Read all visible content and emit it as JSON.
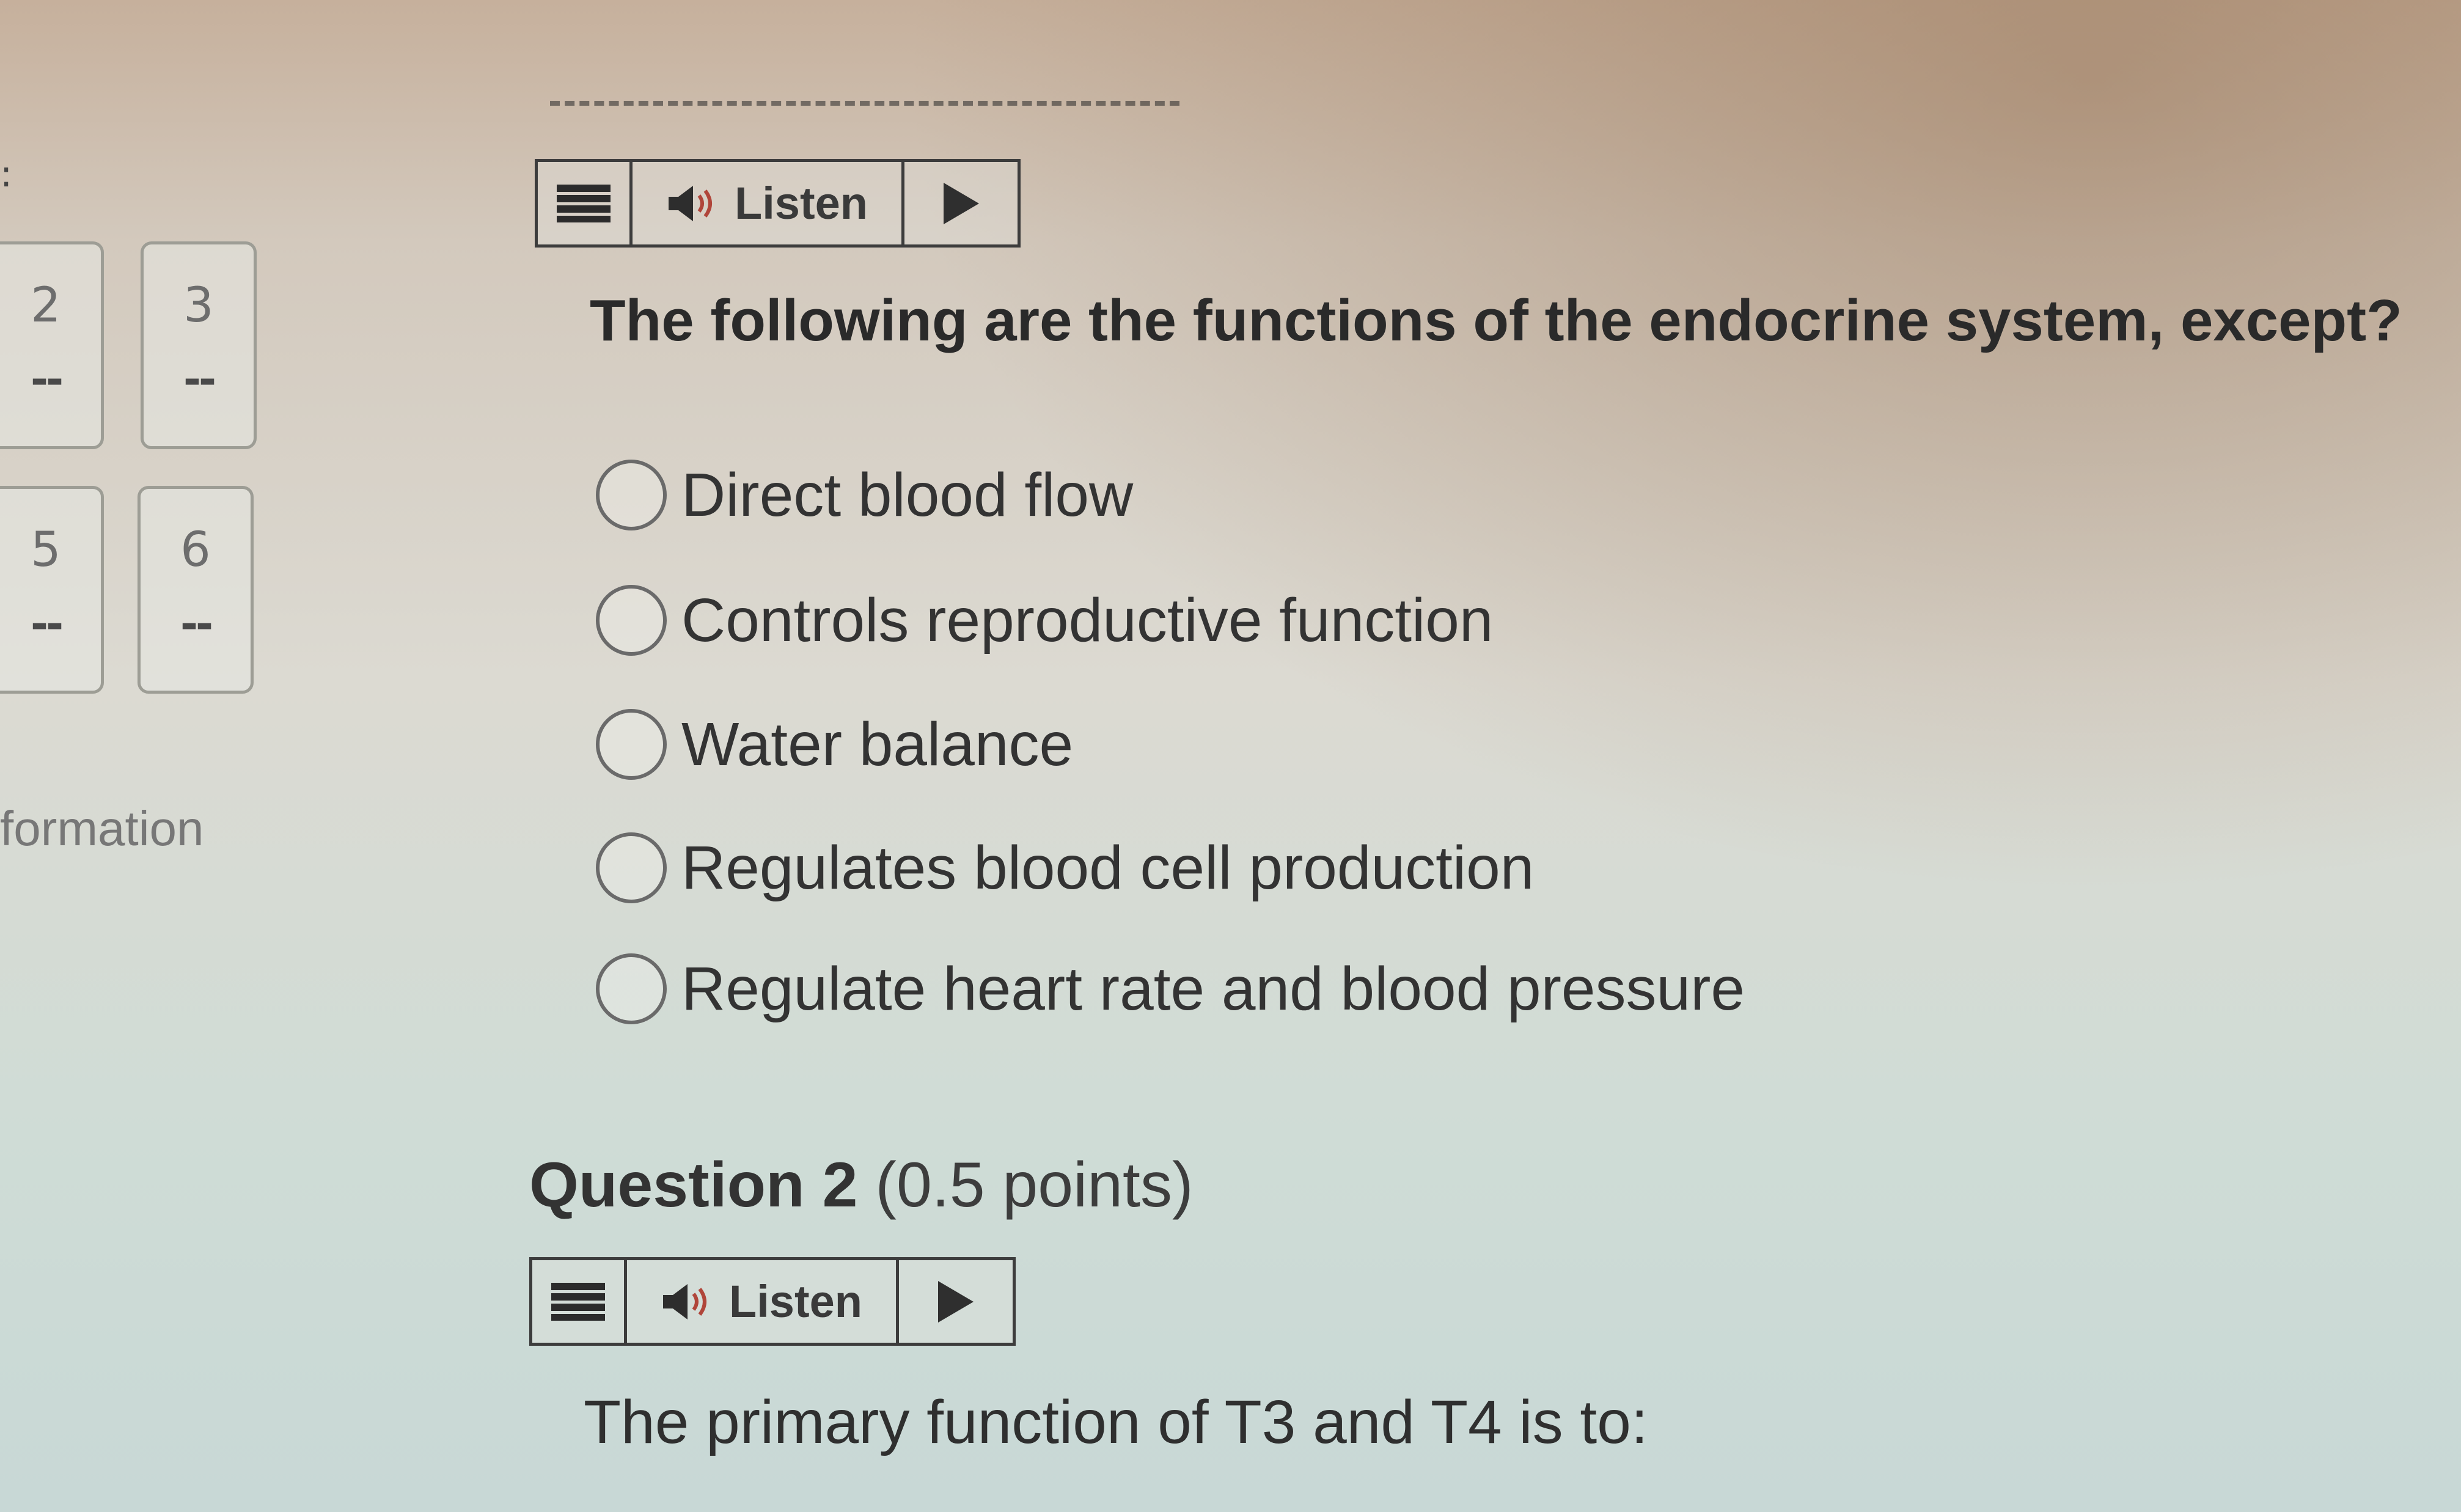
{
  "navigator": {
    "tiles": [
      {
        "number": "2",
        "status": "--"
      },
      {
        "number": "3",
        "status": "--"
      },
      {
        "number": "5",
        "status": "--"
      },
      {
        "number": "6",
        "status": "--"
      }
    ],
    "side_label": "formation"
  },
  "question1": {
    "listen_label": "Listen",
    "text": "The following are the functions of the endocrine system, except?",
    "options": [
      "Direct blood flow",
      "Controls reproductive function",
      "Water balance",
      "Regulates blood cell production",
      "Regulate heart rate and blood pressure"
    ]
  },
  "question2": {
    "title": "Question 2",
    "points": "(0.5 points)",
    "listen_label": "Listen",
    "text": "The primary function of T3 and T4 is to:"
  },
  "icons": {
    "menu": "hamburger-menu-icon",
    "speaker": "speaker-icon",
    "play": "play-icon"
  }
}
